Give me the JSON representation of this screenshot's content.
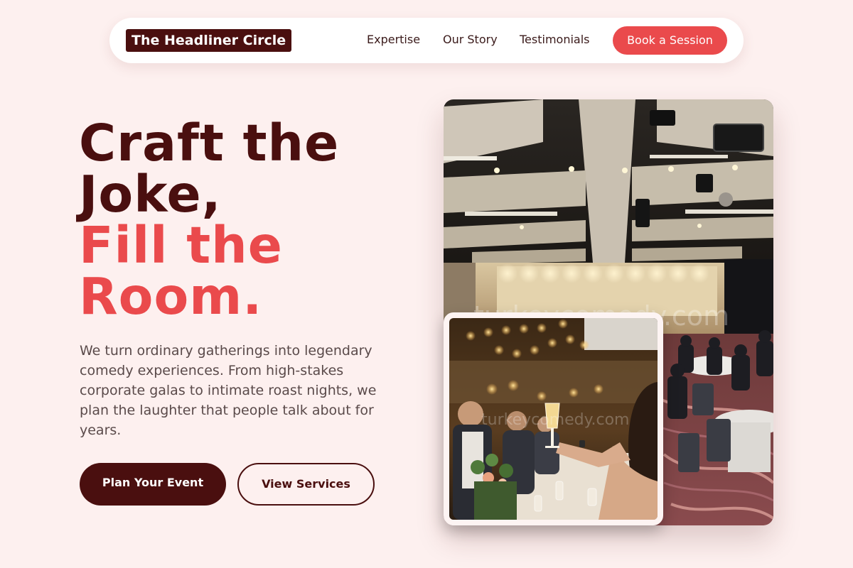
{
  "nav": {
    "logo": "The Headliner Circle",
    "links": [
      "Expertise",
      "Our Story",
      "Testimonials"
    ],
    "cta": "Book a Session"
  },
  "hero": {
    "headline_dark_1": "Craft the",
    "headline_dark_2": "Joke,",
    "headline_red_1": "Fill the",
    "headline_red_2": "Room.",
    "description": "We turn ordinary gatherings into legendary comedy experiences. From high-stakes corporate galas to intimate roast nights, we plan the laughter that people talk about for years.",
    "primary_button": "Plan Your Event",
    "secondary_button": "View Services"
  },
  "photos": {
    "main_watermark": "turkeycomedy.com",
    "inset_watermark": "turkeycomedy.com"
  },
  "colors": {
    "background": "#fdf0ef",
    "dark": "#4a0f0f",
    "accent": "#ea4a4c"
  }
}
